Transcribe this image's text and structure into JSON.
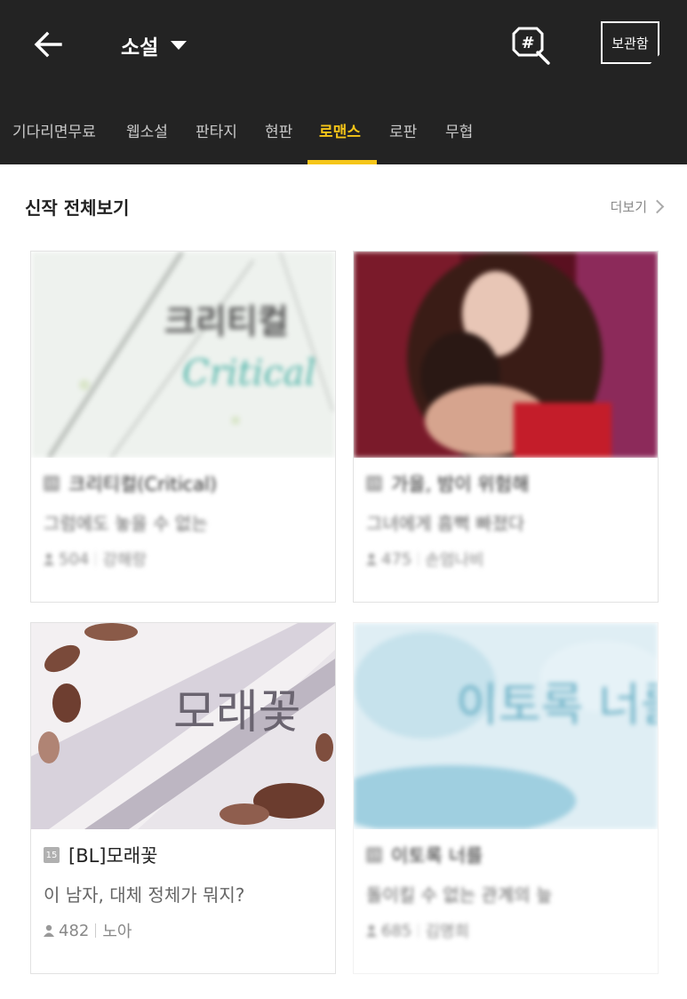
{
  "header": {
    "title": "소설",
    "storage_label": "보관함"
  },
  "tabs": [
    {
      "label": "기다리면무료"
    },
    {
      "label": "웹소설"
    },
    {
      "label": "판타지"
    },
    {
      "label": "현판"
    },
    {
      "label": "로맨스",
      "active": true
    },
    {
      "label": "로판"
    },
    {
      "label": "무협"
    }
  ],
  "section": {
    "title": "신작 전체보기",
    "more_label": "더보기"
  },
  "cards": [
    {
      "cover_text": "크리티컬",
      "cover_subtext": "Critical",
      "title": "크리티컬(Critical)",
      "desc": "그럼에도 놓을 수 없는",
      "views": "504",
      "author": "강해랑",
      "age": "15"
    },
    {
      "title": "가을, 밤이 위험해",
      "desc": "그녀에게 흠뻑 빠졌다",
      "views": "475",
      "author": "손엄나비",
      "age": "15"
    },
    {
      "cover_text": "모래꽃",
      "title": "[BL]모래꽃",
      "desc": "이 남자, 대체 정체가 뭐지?",
      "views": "482",
      "author": "노아",
      "age": "15"
    },
    {
      "cover_text": "이토록 너를",
      "title": "이토록 너를",
      "desc": "돌이킬 수 없는 관계의 늪",
      "views": "685",
      "author": "김명희",
      "age": "15"
    }
  ],
  "icons": [
    "back-arrow-icon",
    "caret-down-icon",
    "hashtag-search-icon",
    "chevron-right-icon",
    "person-icon"
  ],
  "colors": {
    "header_bg": "#232323",
    "accent": "#f5c518"
  }
}
